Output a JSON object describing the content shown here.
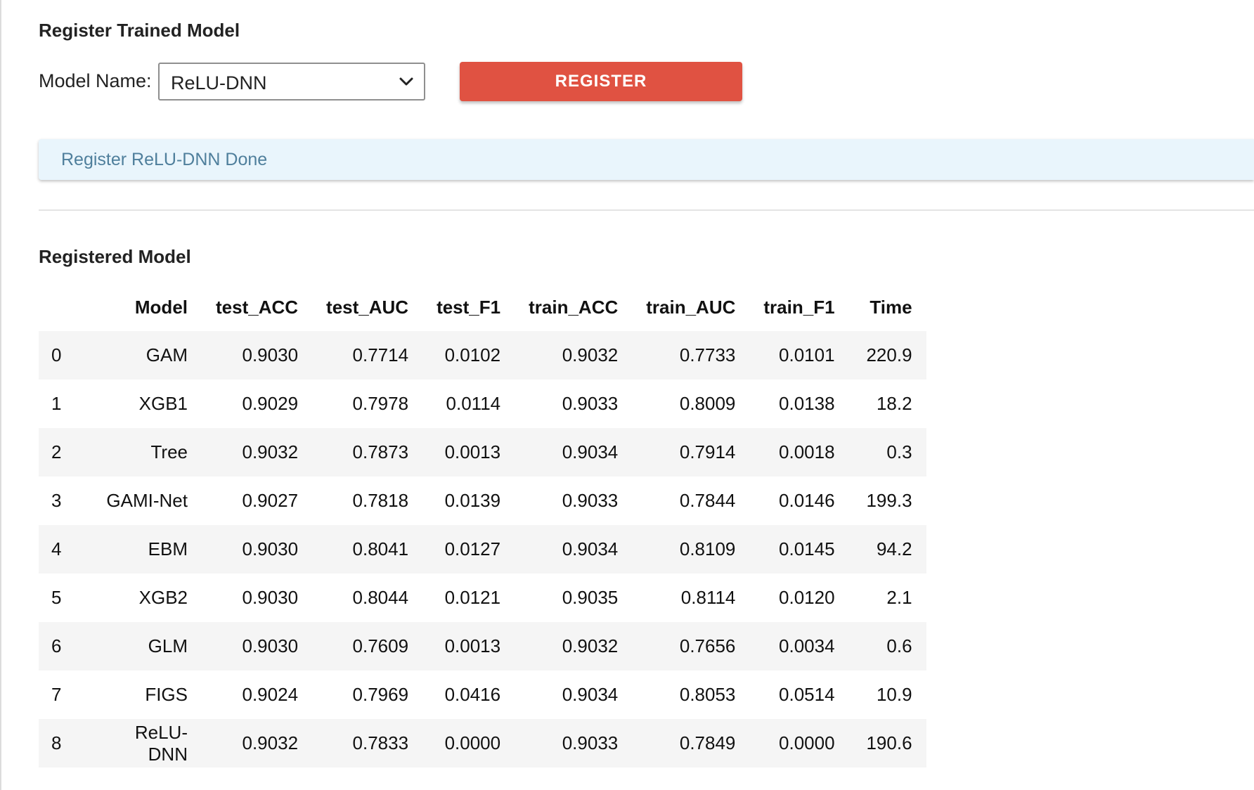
{
  "register_section": {
    "title": "Register Trained Model",
    "model_label": "Model Name:",
    "selected_model": "ReLU-DNN",
    "register_button": "REGISTER",
    "status_message": "Register ReLU-DNN Done"
  },
  "registered_section": {
    "title": "Registered Model",
    "columns": [
      "",
      "Model",
      "test_ACC",
      "test_AUC",
      "test_F1",
      "train_ACC",
      "train_AUC",
      "train_F1",
      "Time"
    ],
    "rows": [
      [
        "0",
        "GAM",
        "0.9030",
        "0.7714",
        "0.0102",
        "0.9032",
        "0.7733",
        "0.0101",
        "220.9"
      ],
      [
        "1",
        "XGB1",
        "0.9029",
        "0.7978",
        "0.0114",
        "0.9033",
        "0.8009",
        "0.0138",
        "18.2"
      ],
      [
        "2",
        "Tree",
        "0.9032",
        "0.7873",
        "0.0013",
        "0.9034",
        "0.7914",
        "0.0018",
        "0.3"
      ],
      [
        "3",
        "GAMI-Net",
        "0.9027",
        "0.7818",
        "0.0139",
        "0.9033",
        "0.7844",
        "0.0146",
        "199.3"
      ],
      [
        "4",
        "EBM",
        "0.9030",
        "0.8041",
        "0.0127",
        "0.9034",
        "0.8109",
        "0.0145",
        "94.2"
      ],
      [
        "5",
        "XGB2",
        "0.9030",
        "0.8044",
        "0.0121",
        "0.9035",
        "0.8114",
        "0.0120",
        "2.1"
      ],
      [
        "6",
        "GLM",
        "0.9030",
        "0.7609",
        "0.0013",
        "0.9032",
        "0.7656",
        "0.0034",
        "0.6"
      ],
      [
        "7",
        "FIGS",
        "0.9024",
        "0.7969",
        "0.0416",
        "0.9034",
        "0.8053",
        "0.0514",
        "10.9"
      ],
      [
        "8",
        "ReLU-DNN",
        "0.9032",
        "0.7833",
        "0.0000",
        "0.9033",
        "0.7849",
        "0.0000",
        "190.6"
      ]
    ]
  },
  "icons": {
    "dropdown": "chevron-down-icon"
  },
  "colors": {
    "register_button": "#e05242",
    "status_background": "#e9f5fc",
    "status_text": "#4f7f9c",
    "row_stripe": "#f5f5f5"
  }
}
